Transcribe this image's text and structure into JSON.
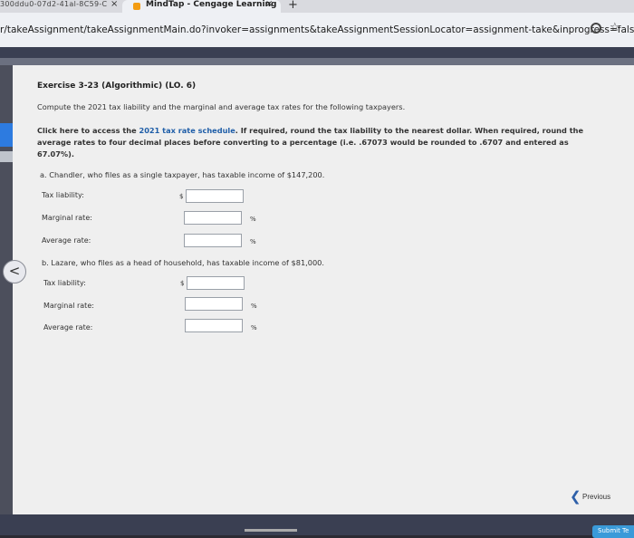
{
  "browser": {
    "tab_left_text": "300ddu0-07d2-41al-8C59-C",
    "tab_left_close": "×",
    "active_tab_title": "MindTap - Cengage Learning",
    "active_tab_close": "×",
    "new_tab": "+",
    "url": "r/takeAssignment/takeAssignmentMain.do?invoker=assignments&takeAssignmentSessionLocator=assignment-take&inprogress=false"
  },
  "exercise": {
    "title": "Exercise 3-23 (Algorithmic) (LO. 6)",
    "intro": "Compute the 2021 tax liability and the marginal and average tax rates for the following taxpayers.",
    "instr_lead": "Click here to access the ",
    "instr_link": "2021 tax rate schedule",
    "instr_rest": ". If required, round the tax liability to the nearest dollar. When required, round the average rates to four decimal places before converting to a percentage (i.e. .67073 would be rounded to .6707 and entered as 67.07%)."
  },
  "part_a": {
    "prompt": "a. Chandler, who files as a single taxpayer, has taxable income of $147,200.",
    "tax_label": "Tax liability:",
    "marginal_label": "Marginal rate:",
    "average_label": "Average rate:",
    "currency": "$",
    "percent": "%",
    "tax_value": "",
    "marginal_value": "",
    "average_value": ""
  },
  "part_b": {
    "prompt": "b. Lazare, who files as a head of household, has taxable income of $81,000.",
    "tax_label": "Tax liability:",
    "marginal_label": "Marginal rate:",
    "average_label": "Average rate:",
    "currency": "$",
    "percent": "%",
    "tax_value": "",
    "marginal_value": "",
    "average_value": ""
  },
  "nav": {
    "previous_label": "Previous",
    "submit_label": "Submit Te",
    "back_glyph": "<"
  },
  "colors": {
    "link": "#1f5ea8",
    "accent": "#2d7be0"
  }
}
